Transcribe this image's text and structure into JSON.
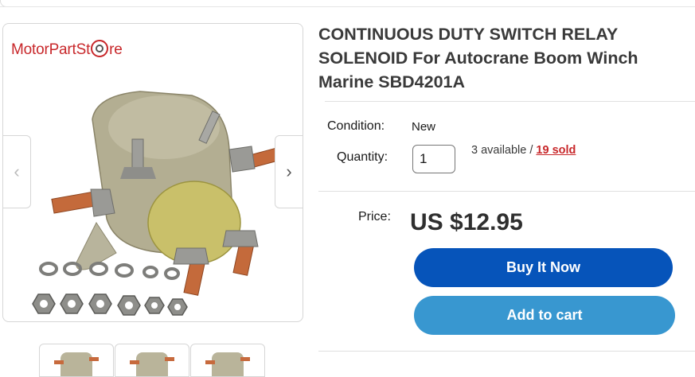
{
  "gallery": {
    "brand_prefix": "MotorPartSt",
    "brand_suffix": "re",
    "prev_arrow": "‹",
    "next_arrow": "›",
    "icons": {
      "prev": "chevron-left-icon",
      "next": "chevron-right-icon"
    }
  },
  "product": {
    "title": "CONTINUOUS DUTY SWITCH RELAY SOLENOID For Autocrane Boom Winch Marine SBD4201A",
    "condition_label": "Condition:",
    "condition_value": "New",
    "quantity_label": "Quantity:",
    "quantity_value": "1",
    "available_text": "3 available / ",
    "sold_link": "19 sold",
    "price_label": "Price:",
    "price_value": "US $12.95"
  },
  "buttons": {
    "buy_now": "Buy It Now",
    "add_to_cart": "Add to cart"
  },
  "colors": {
    "buy_now_bg": "#0654ba",
    "add_to_cart_bg": "#3897d0",
    "sold_link": "#c8282b",
    "brand": "#c8282b"
  }
}
